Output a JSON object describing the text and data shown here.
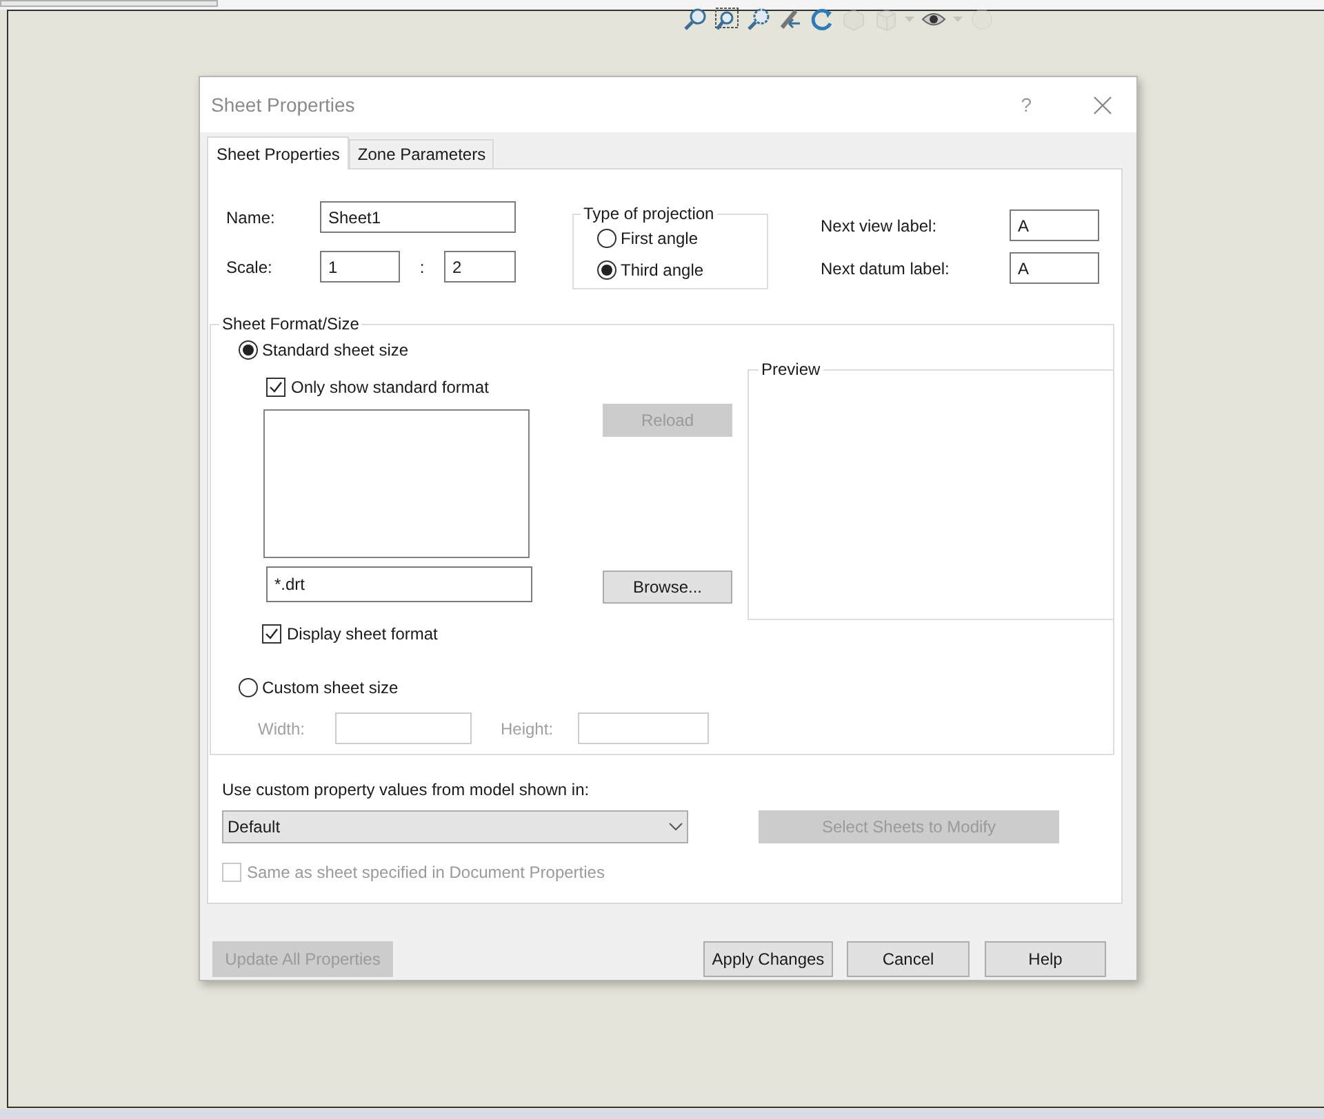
{
  "toolbar": [
    {
      "kind": "zoom-fit",
      "disabled": false
    },
    {
      "kind": "zoom-area",
      "disabled": false
    },
    {
      "kind": "zoom-selection",
      "disabled": false
    },
    {
      "kind": "previous-view",
      "disabled": false
    },
    {
      "kind": "rotate",
      "disabled": false
    },
    {
      "kind": "section",
      "disabled": true
    },
    {
      "kind": "display-style",
      "disabled": true
    },
    {
      "kind": "caret",
      "disabled": true
    },
    {
      "kind": "eye",
      "disabled": false
    },
    {
      "kind": "caret",
      "disabled": true
    },
    {
      "kind": "sphere",
      "disabled": true
    }
  ],
  "window": {
    "title": "Sheet Properties",
    "help": "?"
  },
  "tabs": [
    {
      "label": "Sheet Properties",
      "selected": true
    },
    {
      "label": "Zone Parameters",
      "selected": false
    }
  ],
  "name": {
    "label": "Name:",
    "value": "Sheet1"
  },
  "scale": {
    "label": "Scale:",
    "value_1": "1",
    "separator": ":",
    "value_2": "2"
  },
  "projection": {
    "title": "Type of projection",
    "options": [
      {
        "label": "First angle",
        "selected": false
      },
      {
        "label": "Third angle",
        "selected": true
      }
    ]
  },
  "next_view_label": {
    "label": "Next view label:",
    "value": "A"
  },
  "next_datum_label": {
    "label": "Next datum label:",
    "value": "A"
  },
  "sheet_format": {
    "title": "Sheet Format/Size",
    "sizes": [
      {
        "label": "Standard sheet size",
        "selected": true
      },
      {
        "label": "Custom sheet size",
        "selected": false
      }
    ],
    "only_standard": {
      "label": "Only show standard format",
      "checked": true
    },
    "filter": "*.drt",
    "reload": {
      "label": "Reload",
      "disabled": true
    },
    "browse": {
      "label": "Browse...",
      "disabled": false
    },
    "display_format": {
      "label": "Display sheet format",
      "checked": true
    },
    "width": {
      "label": "Width:",
      "disabled": true
    },
    "height": {
      "label": "Height:",
      "disabled": true
    },
    "preview": {
      "title": "Preview"
    }
  },
  "custom_property": {
    "label": "Use custom property values from model shown in:",
    "value": "Default",
    "select_sheets": {
      "label": "Select Sheets to Modify",
      "disabled": true
    },
    "same_as": {
      "label": "Same as sheet specified in Document Properties",
      "checked": false,
      "disabled": true
    }
  },
  "buttons": [
    {
      "label": "Update All Properties",
      "disabled": true
    },
    {
      "label": "Apply Changes",
      "disabled": false
    },
    {
      "label": "Cancel",
      "disabled": false
    },
    {
      "label": "Help",
      "disabled": false
    }
  ]
}
